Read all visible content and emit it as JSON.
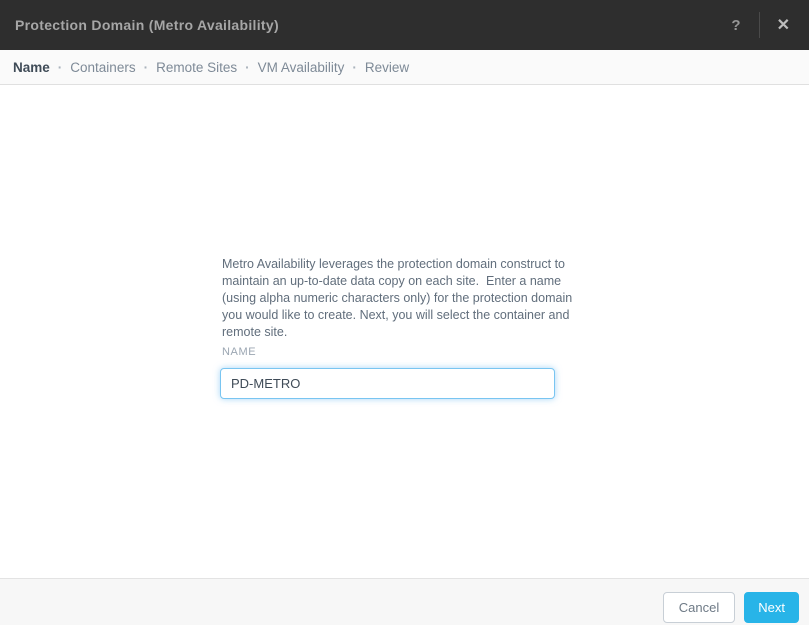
{
  "titlebar": {
    "title": "Protection Domain (Metro Availability)",
    "help_icon": "?",
    "close_icon": "✕"
  },
  "steps": {
    "separator": "·",
    "items": [
      {
        "label": "Name",
        "active": true
      },
      {
        "label": "Containers",
        "active": false
      },
      {
        "label": "Remote Sites",
        "active": false
      },
      {
        "label": "VM Availability",
        "active": false
      },
      {
        "label": "Review",
        "active": false
      }
    ]
  },
  "body": {
    "description": "Metro Availability leverages the protection domain construct to maintain an up-to-date data copy on each site.  Enter a name (using alpha numeric characters only) for the protection domain you would like to create. Next, you will select the container and remote site.",
    "name_field": {
      "label": "NAME",
      "value": "PD-METRO"
    }
  },
  "footer": {
    "cancel_label": "Cancel",
    "next_label": "Next"
  },
  "colors": {
    "titlebar_bg": "#2e2e2e",
    "accent": "#28b4e8",
    "input_focus_border": "#79c5f1",
    "steps_bg": "#fafafa",
    "footer_bg": "#f7f7f7"
  }
}
